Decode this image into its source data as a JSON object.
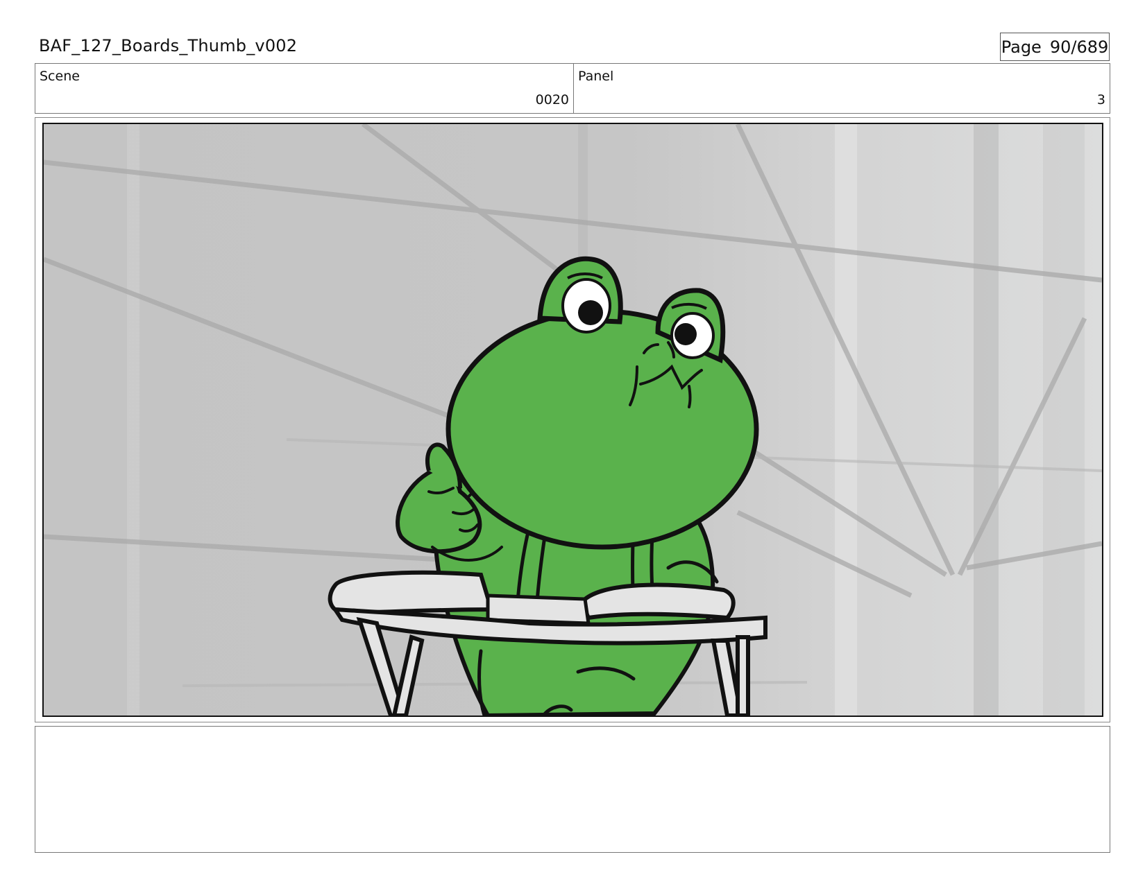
{
  "header": {
    "document_title": "BAF_127_Boards_Thumb_v002",
    "page_label": "Page",
    "page_number": "90/689"
  },
  "info": {
    "scene_label": "Scene",
    "scene_value": "0020",
    "panel_label": "Panel",
    "panel_value": "3"
  },
  "artwork": {
    "subject": "frog-character-at-lectern",
    "colors": {
      "frog_green": "#5ab24c",
      "background_gray": "#c9c9c9",
      "outline": "#111111",
      "lectern": "#e4e4e4"
    }
  },
  "notes": {
    "text": ""
  }
}
